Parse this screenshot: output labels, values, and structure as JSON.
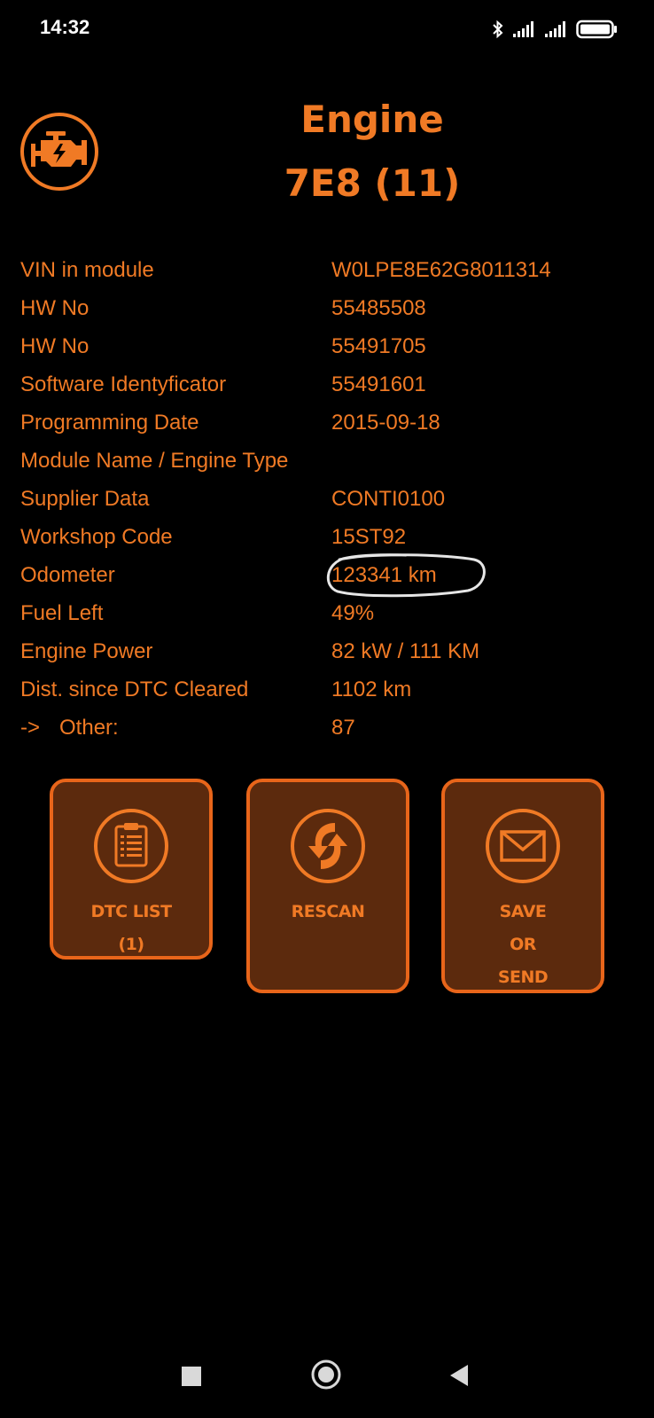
{
  "status_bar": {
    "time": "14:32",
    "icons": [
      "bluetooth-icon",
      "signal-icon",
      "signal-icon",
      "battery-icon"
    ]
  },
  "header": {
    "title": "Engine",
    "subtitle": "7E8 (11)",
    "icon": "check-engine-icon"
  },
  "info_rows": [
    {
      "label": "VIN in module",
      "value": "W0LPE8E62G8011314"
    },
    {
      "label": "HW No",
      "value": "55485508"
    },
    {
      "label": "HW No",
      "value": "55491705"
    },
    {
      "label": "Software Identyficator",
      "value": "55491601"
    },
    {
      "label": "Programming Date",
      "value": "2015-09-18"
    },
    {
      "label": "Module Name / Engine Type",
      "value": ""
    },
    {
      "label": "Supplier Data",
      "value": "CONTI0100"
    },
    {
      "label": "Workshop Code",
      "value": "15ST92"
    },
    {
      "label": "Odometer",
      "value": "123341 km"
    },
    {
      "label": "Fuel Left",
      "value": "49%"
    },
    {
      "label": "Engine Power",
      "value": "82 kW / 111 KM"
    },
    {
      "label": "Dist. since DTC Cleared",
      "value": "1102 km"
    },
    {
      "label_arrow": "->",
      "label": "Other:",
      "value": "87"
    }
  ],
  "buttons": {
    "dtc": {
      "line1": "DTC LIST",
      "line2": "(1)",
      "icon": "clipboard-icon"
    },
    "rescan": {
      "line1": "RESCAN",
      "icon": "rescan-arrows-icon"
    },
    "save": {
      "line1": "SAVE",
      "line2": "OR",
      "line3": "SEND",
      "icon": "envelope-icon"
    }
  },
  "colors": {
    "accent": "#f07a25",
    "button_bg": "#5c2a0d",
    "button_border": "#e8651a",
    "background": "#000000"
  },
  "nav": [
    "recent-apps-icon",
    "home-icon",
    "back-icon"
  ]
}
